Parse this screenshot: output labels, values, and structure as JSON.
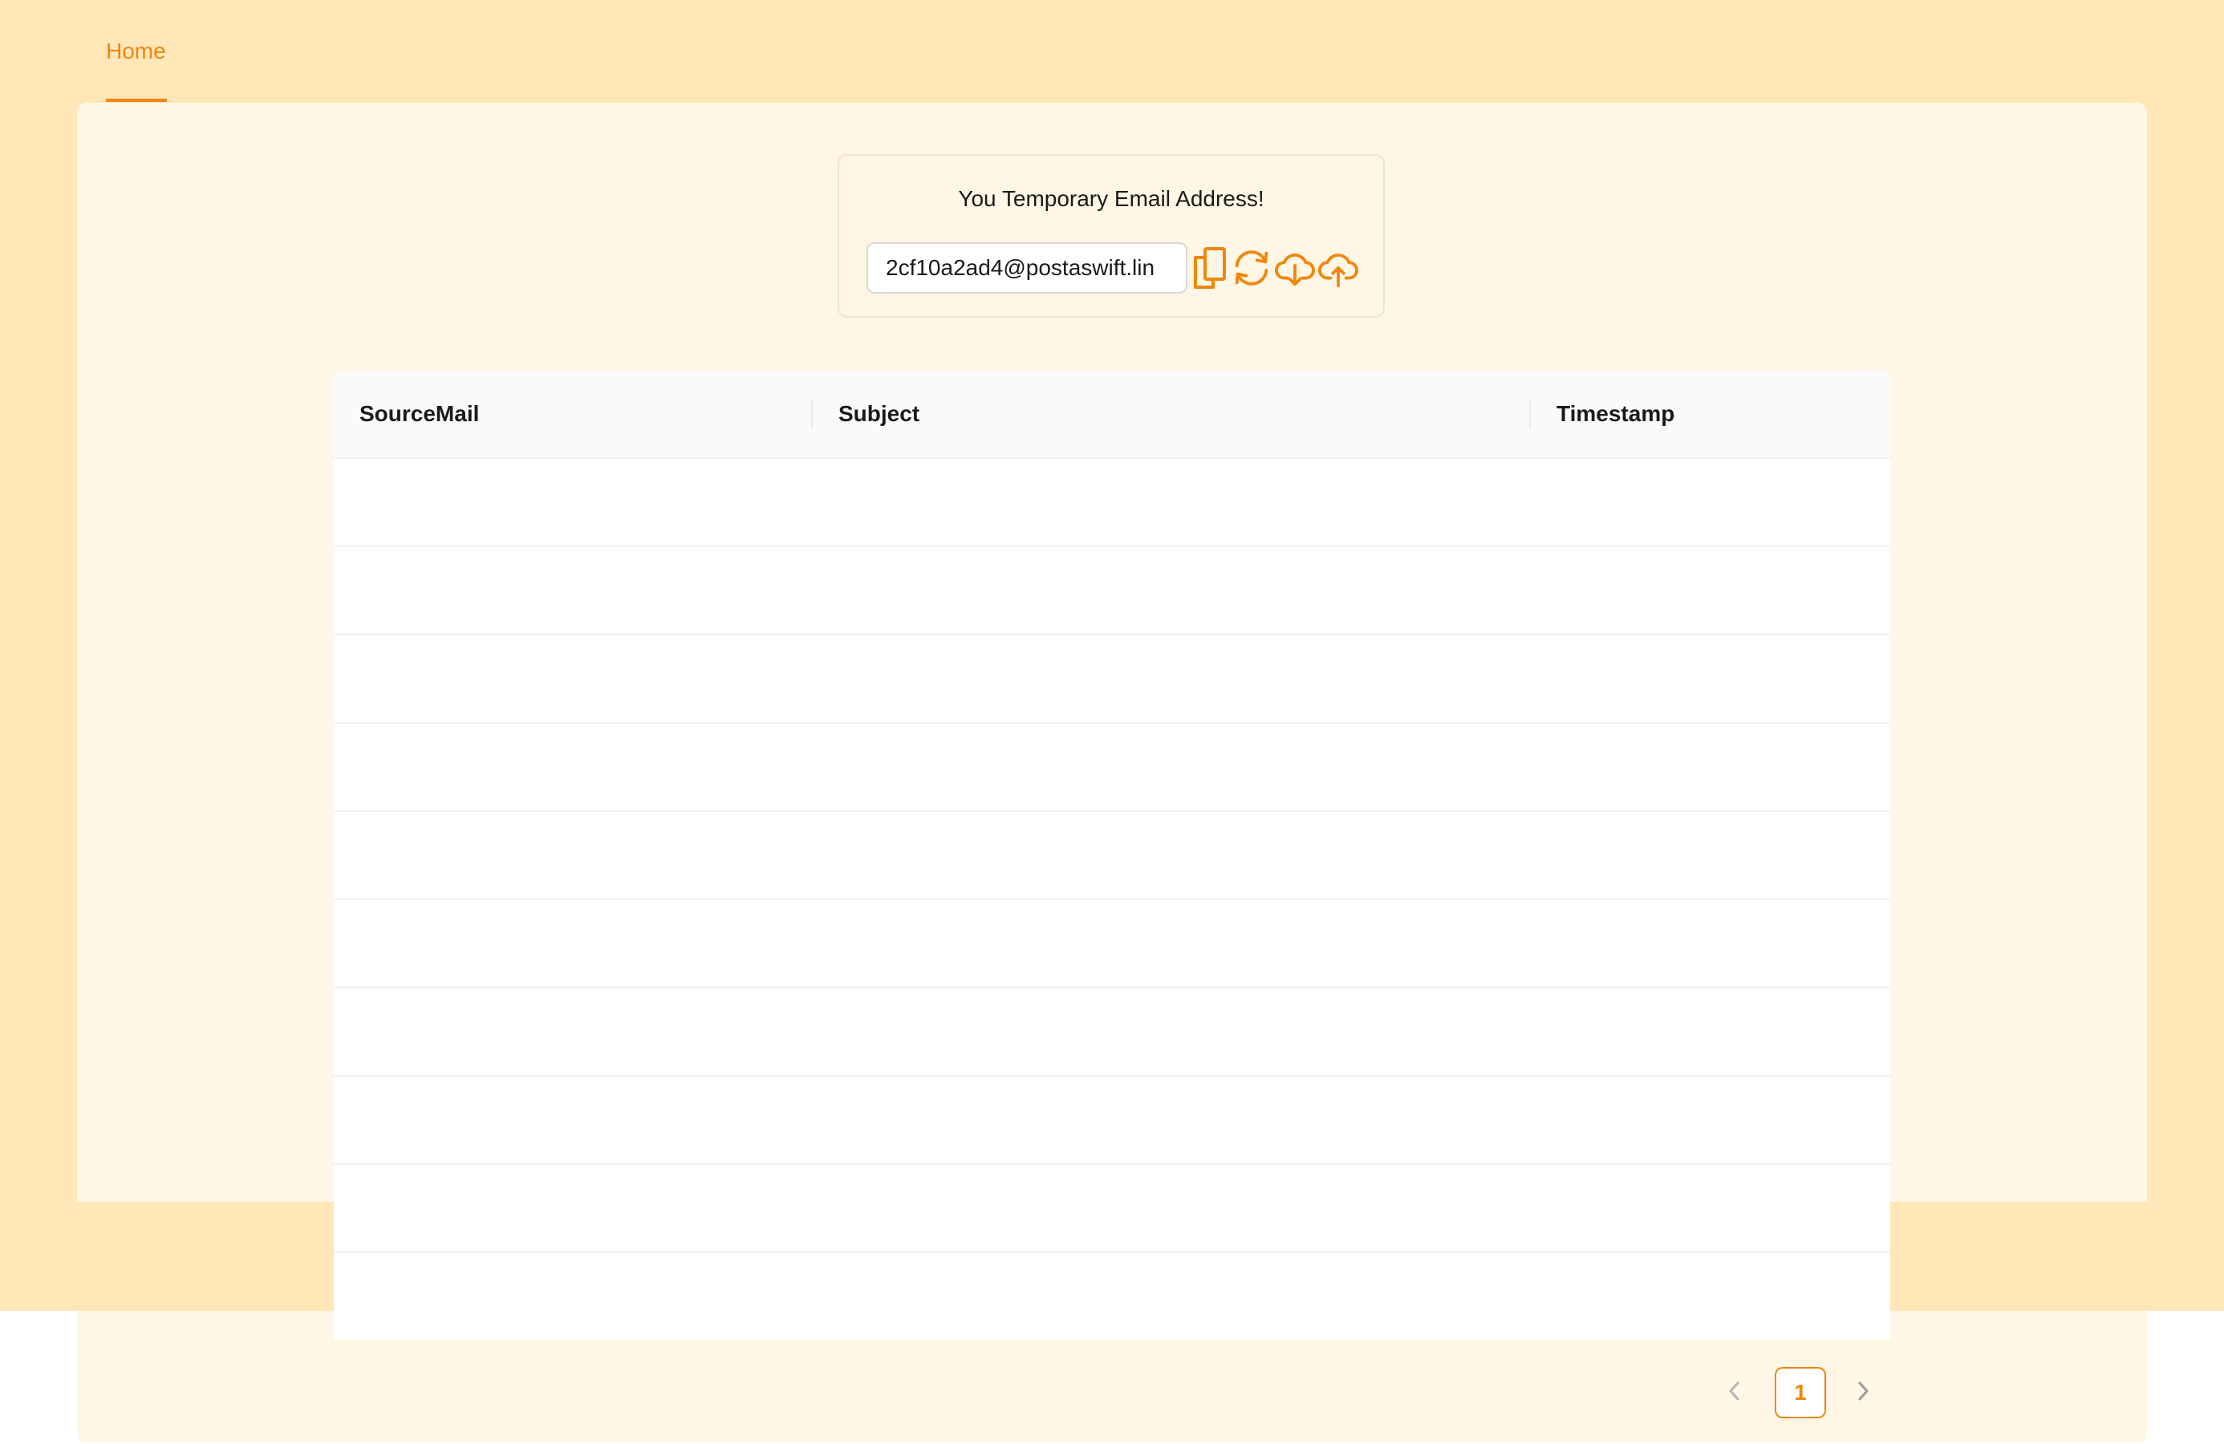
{
  "nav": {
    "tabs": [
      {
        "label": "Home",
        "active": true
      }
    ]
  },
  "email_panel": {
    "title": "You Temporary Email Address!",
    "address": "2cf10a2ad4@postaswift.lin",
    "actions": [
      {
        "icon": "copy-icon"
      },
      {
        "icon": "refresh-icon"
      },
      {
        "icon": "cloud-download-icon"
      },
      {
        "icon": "cloud-upload-icon"
      }
    ]
  },
  "table": {
    "columns": [
      "SourceMail",
      "Subject",
      "Timestamp"
    ],
    "rows": []
  },
  "pagination": {
    "prev_icon": "chevron-left-icon",
    "current_page": "1",
    "next_icon": "chevron-right-icon"
  },
  "colors": {
    "accent": "#f0870c",
    "page_background": "#ffe7b8",
    "card_background": "#fff6e5"
  }
}
